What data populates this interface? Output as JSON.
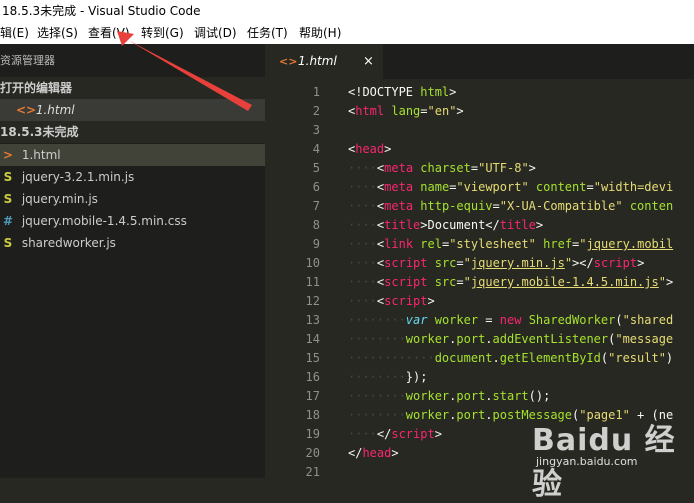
{
  "window": {
    "title": "18.5.3未完成 - Visual Studio Code"
  },
  "menu": [
    "辑(E)",
    "选择(S)",
    "查看(V)",
    "转到(G)",
    "调试(D)",
    "任务(T)",
    "帮助(H)"
  ],
  "sidebar": {
    "title": "资源管理器",
    "open_editors_header": "打开的编辑器",
    "open_editors": [
      {
        "icon": "<>",
        "name": "1.html"
      }
    ],
    "folder_header": "18.5.3未完成",
    "files": [
      {
        "icon": ">",
        "name": "1.html"
      },
      {
        "icon": "S",
        "name": "jquery-3.2.1.min.js"
      },
      {
        "icon": "S",
        "name": "jquery.min.js"
      },
      {
        "icon": "#",
        "name": "jquery.mobile-1.4.5.min.css"
      },
      {
        "icon": "S",
        "name": "sharedworker.js"
      }
    ]
  },
  "tab": {
    "icon": "<>",
    "name": "1.html",
    "close": "×"
  },
  "line_numbers": [
    "1",
    "2",
    "3",
    "4",
    "5",
    "6",
    "7",
    "8",
    "9",
    "10",
    "11",
    "12",
    "13",
    "14",
    "15",
    "16",
    "17",
    "18",
    "19",
    "20",
    "21"
  ],
  "code_lines": [
    [
      [
        "pu",
        "<!DOCTYPE "
      ],
      [
        "at",
        "html"
      ],
      [
        "pu",
        ">"
      ]
    ],
    [
      [
        "pu",
        "<"
      ],
      [
        "tg",
        "html"
      ],
      [
        "pu",
        " "
      ],
      [
        "at",
        "lang"
      ],
      [
        "pu",
        "="
      ],
      [
        "st",
        "\"en\""
      ],
      [
        "pu",
        ">"
      ]
    ],
    [],
    [
      [
        "pu",
        "<"
      ],
      [
        "tg",
        "head"
      ],
      [
        "pu",
        ">"
      ]
    ],
    [
      [
        "guide",
        "····"
      ],
      [
        "pu",
        "<"
      ],
      [
        "tg",
        "meta"
      ],
      [
        "pu",
        " "
      ],
      [
        "at",
        "charset"
      ],
      [
        "pu",
        "="
      ],
      [
        "st",
        "\"UTF-8\""
      ],
      [
        "pu",
        ">"
      ]
    ],
    [
      [
        "guide",
        "····"
      ],
      [
        "pu",
        "<"
      ],
      [
        "tg",
        "meta"
      ],
      [
        "pu",
        " "
      ],
      [
        "at",
        "name"
      ],
      [
        "pu",
        "="
      ],
      [
        "st",
        "\"viewport\""
      ],
      [
        "pu",
        " "
      ],
      [
        "at",
        "content"
      ],
      [
        "pu",
        "="
      ],
      [
        "st",
        "\"width=devi"
      ]
    ],
    [
      [
        "guide",
        "····"
      ],
      [
        "pu",
        "<"
      ],
      [
        "tg",
        "meta"
      ],
      [
        "pu",
        " "
      ],
      [
        "at",
        "http-equiv"
      ],
      [
        "pu",
        "="
      ],
      [
        "st",
        "\"X-UA-Compatible\""
      ],
      [
        "pu",
        " "
      ],
      [
        "at",
        "conten"
      ]
    ],
    [
      [
        "guide",
        "····"
      ],
      [
        "pu",
        "<"
      ],
      [
        "tg",
        "title"
      ],
      [
        "pu",
        ">Document</"
      ],
      [
        "tg",
        "title"
      ],
      [
        "pu",
        ">"
      ]
    ],
    [
      [
        "guide",
        "····"
      ],
      [
        "pu",
        "<"
      ],
      [
        "tg",
        "link"
      ],
      [
        "pu",
        " "
      ],
      [
        "at",
        "rel"
      ],
      [
        "pu",
        "="
      ],
      [
        "st",
        "\"stylesheet\""
      ],
      [
        "pu",
        " "
      ],
      [
        "at",
        "href"
      ],
      [
        "pu",
        "="
      ],
      [
        "st",
        "\""
      ],
      [
        "stu",
        "jquery.mobil"
      ]
    ],
    [
      [
        "guide",
        "····"
      ],
      [
        "pu",
        "<"
      ],
      [
        "tg",
        "script"
      ],
      [
        "pu",
        " "
      ],
      [
        "at",
        "src"
      ],
      [
        "pu",
        "="
      ],
      [
        "st",
        "\""
      ],
      [
        "stu",
        "jquery.min.js"
      ],
      [
        "st",
        "\""
      ],
      [
        "pu",
        "></"
      ],
      [
        "tg",
        "script"
      ],
      [
        "pu",
        ">"
      ]
    ],
    [
      [
        "guide",
        "····"
      ],
      [
        "pu",
        "<"
      ],
      [
        "tg",
        "script"
      ],
      [
        "pu",
        " "
      ],
      [
        "at",
        "src"
      ],
      [
        "pu",
        "="
      ],
      [
        "st",
        "\""
      ],
      [
        "stu",
        "jquery.mobile-1.4.5.min.js"
      ],
      [
        "st",
        "\""
      ],
      [
        "pu",
        ">"
      ]
    ],
    [
      [
        "guide",
        "····"
      ],
      [
        "pu",
        "<"
      ],
      [
        "tg",
        "script"
      ],
      [
        "pu",
        ">"
      ]
    ],
    [
      [
        "guide",
        "········"
      ],
      [
        "kw",
        "var"
      ],
      [
        "pu",
        " "
      ],
      [
        "at",
        "worker"
      ],
      [
        "pu",
        " = "
      ],
      [
        "tg",
        "new"
      ],
      [
        "pu",
        " "
      ],
      [
        "at",
        "SharedWorker"
      ],
      [
        "pu",
        "("
      ],
      [
        "st",
        "\"shared"
      ]
    ],
    [
      [
        "guide",
        "········"
      ],
      [
        "at",
        "worker"
      ],
      [
        "pu",
        "."
      ],
      [
        "at",
        "port"
      ],
      [
        "pu",
        "."
      ],
      [
        "at",
        "addEventListener"
      ],
      [
        "pu",
        "("
      ],
      [
        "st",
        "\"message"
      ]
    ],
    [
      [
        "guide",
        "············"
      ],
      [
        "at",
        "document"
      ],
      [
        "pu",
        "."
      ],
      [
        "at",
        "getElementById"
      ],
      [
        "pu",
        "("
      ],
      [
        "st",
        "\"result\""
      ],
      [
        "pu",
        ")"
      ]
    ],
    [
      [
        "guide",
        "········"
      ],
      [
        "pu",
        "});"
      ]
    ],
    [
      [
        "guide",
        "········"
      ],
      [
        "at",
        "worker"
      ],
      [
        "pu",
        "."
      ],
      [
        "at",
        "port"
      ],
      [
        "pu",
        "."
      ],
      [
        "at",
        "start"
      ],
      [
        "pu",
        "();"
      ]
    ],
    [
      [
        "guide",
        "········"
      ],
      [
        "at",
        "worker"
      ],
      [
        "pu",
        "."
      ],
      [
        "at",
        "port"
      ],
      [
        "pu",
        "."
      ],
      [
        "at",
        "postMessage"
      ],
      [
        "pu",
        "("
      ],
      [
        "st",
        "\"page1\""
      ],
      [
        "pu",
        " + (ne"
      ]
    ],
    [
      [
        "guide",
        "····"
      ],
      [
        "pu",
        "</"
      ],
      [
        "tg",
        "script"
      ],
      [
        "pu",
        ">"
      ]
    ],
    [
      [
        "pu",
        "</"
      ],
      [
        "tg",
        "head"
      ],
      [
        "pu",
        ">"
      ]
    ],
    []
  ],
  "watermark": {
    "brand": "Baidu 经验",
    "url": "jingyan.baidu.com"
  },
  "colors": {
    "arrow": "#e8403a",
    "background": "#272822",
    "sidebar": "#1e1f1c",
    "tag": "#f92672",
    "attr": "#a6e22e",
    "string": "#e6db74"
  }
}
